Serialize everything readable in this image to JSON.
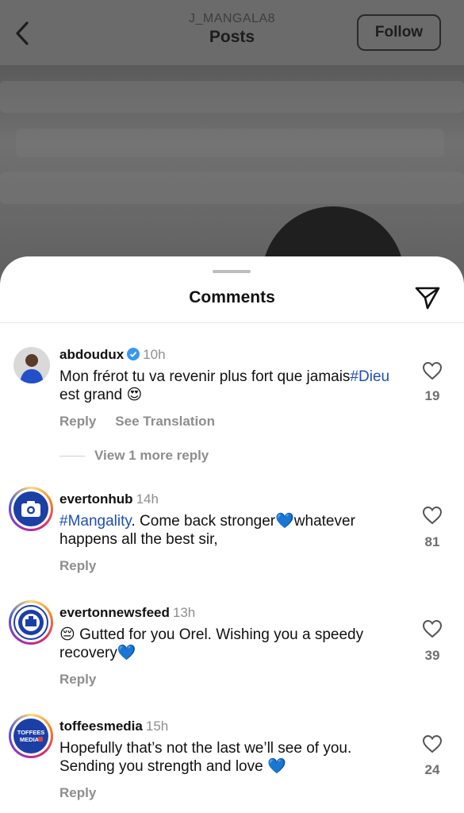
{
  "header": {
    "username": "J_MANGALA8",
    "title": "Posts",
    "follow_label": "Follow"
  },
  "sheet": {
    "title": "Comments"
  },
  "comments": [
    {
      "username": "abdoudux",
      "verified": true,
      "time": "10h",
      "text_before_tag": "Mon frérot tu va revenir plus fort que jamais",
      "tag": "#Dieu",
      "text_after_tag": " est grand",
      "emoji": "😍",
      "likes": "19",
      "reply_label": "Reply",
      "translation_label": "See Translation",
      "more_replies": "View 1 more reply"
    },
    {
      "username": "evertonhub",
      "time": "14h",
      "tag": "#Mangality",
      "text_a": ". Come back stronger",
      "emoji": "💙",
      "text_b": "whatever happens all the best sir,",
      "likes": "81",
      "reply_label": "Reply"
    },
    {
      "username": "evertonnewsfeed",
      "time": "13h",
      "emoji_lead": "😔",
      "text_a": "Gutted for you Orel. Wishing you a speedy recovery",
      "emoji": "💙",
      "likes": "39",
      "reply_label": "Reply"
    },
    {
      "username": "toffeesmedia",
      "time": "15h",
      "text_a": "Hopefully that’s not the last we’ll see of you. Sending you strength and love",
      "emoji": "💙",
      "likes": "24",
      "reply_label": "Reply",
      "avatar_text": "TOFFEES MEDIA"
    }
  ],
  "colors": {
    "hashtag": "#1f4fb3",
    "verified_badge": "#3897f0",
    "everton_blue": "#1c3fa6"
  },
  "icons": {
    "back": "chevron-left-icon",
    "share": "paper-plane-icon",
    "like": "heart-outline-icon",
    "verified": "verified-badge-icon"
  }
}
